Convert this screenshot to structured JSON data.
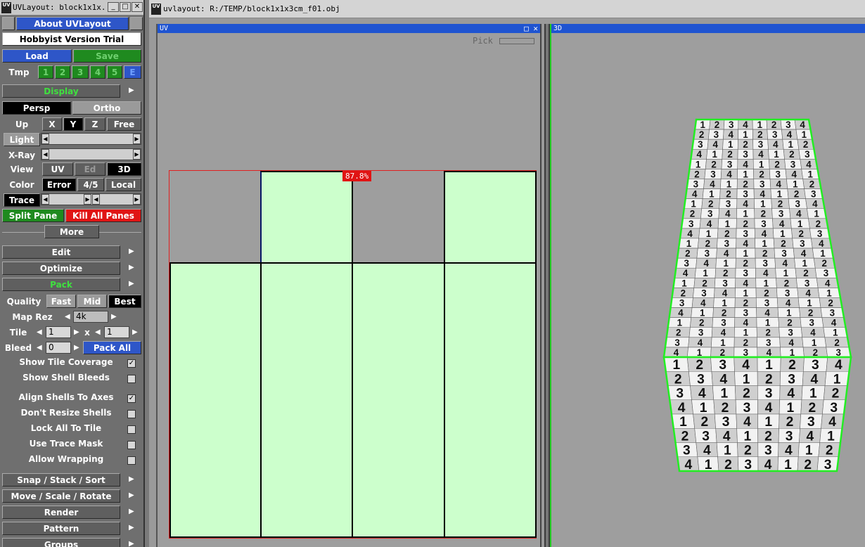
{
  "panel": {
    "title": "UVLayout: block1x1x...",
    "logo": "UV",
    "window_buttons": [
      "_",
      "□",
      "✕"
    ],
    "about": "About UVLayout",
    "license": "Hobbyist Version Trial",
    "load": "Load",
    "save": "Save",
    "tmp_label": "Tmp",
    "tmp_slots": [
      "1",
      "2",
      "3",
      "4",
      "5",
      "E"
    ],
    "display": "Display",
    "persp": "Persp",
    "ortho": "Ortho",
    "up_label": "Up",
    "up_options": [
      "X",
      "Y",
      "Z",
      "Free"
    ],
    "light": "Light",
    "xray": "X-Ray",
    "view_label": "View",
    "view_options": [
      "UV",
      "Ed",
      "3D"
    ],
    "color_label": "Color",
    "color_options": [
      "Error",
      "4/5",
      "Local"
    ],
    "trace": "Trace",
    "split_pane": "Split Pane",
    "kill_all_panes": "Kill All Panes",
    "more": "More",
    "edit": "Edit",
    "optimize": "Optimize",
    "pack": "Pack",
    "quality_label": "Quality",
    "quality_options": [
      "Fast",
      "Mid",
      "Best"
    ],
    "map_rez_label": "Map Rez",
    "map_rez_value": "4k",
    "tile_label": "Tile",
    "tile_x": "1",
    "tile_times": "x",
    "tile_y": "1",
    "bleed_label": "Bleed",
    "bleed_value": "0",
    "pack_all": "Pack All",
    "options": [
      {
        "label": "Show Tile Coverage",
        "checked": true
      },
      {
        "label": "Show Shell Bleeds",
        "checked": false
      },
      {
        "label": "Align Shells To Axes",
        "checked": true
      },
      {
        "label": "Don't Resize Shells",
        "checked": false
      },
      {
        "label": "Lock All To Tile",
        "checked": false
      },
      {
        "label": "Use Trace Mask",
        "checked": false
      },
      {
        "label": "Allow Wrapping",
        "checked": false
      }
    ],
    "checkmark": "✓",
    "snap": "Snap / Stack / Sort",
    "move": "Move / Scale / Rotate",
    "render": "Render",
    "pattern": "Pattern",
    "groups": "Groups",
    "expand_arrow": "▶",
    "left_arrow": "◀",
    "right_arrow": "▶"
  },
  "main": {
    "title": "uvlayout: R:/TEMP/block1x1x3cm_f01.obj",
    "uv_pane_label": "UV",
    "uv_pane_buttons": "□ ✕",
    "pick_label": "Pick",
    "coverage": "87.8%",
    "d3_pane_label": "3D",
    "tile_digits": [
      "1",
      "2",
      "3",
      "4"
    ]
  },
  "colors": {
    "accent_blue": "#2e56c8",
    "green": "#1f8a1f",
    "red": "#e01414",
    "shell_fill": "#ccffcc",
    "edge_green": "#22ee22"
  }
}
